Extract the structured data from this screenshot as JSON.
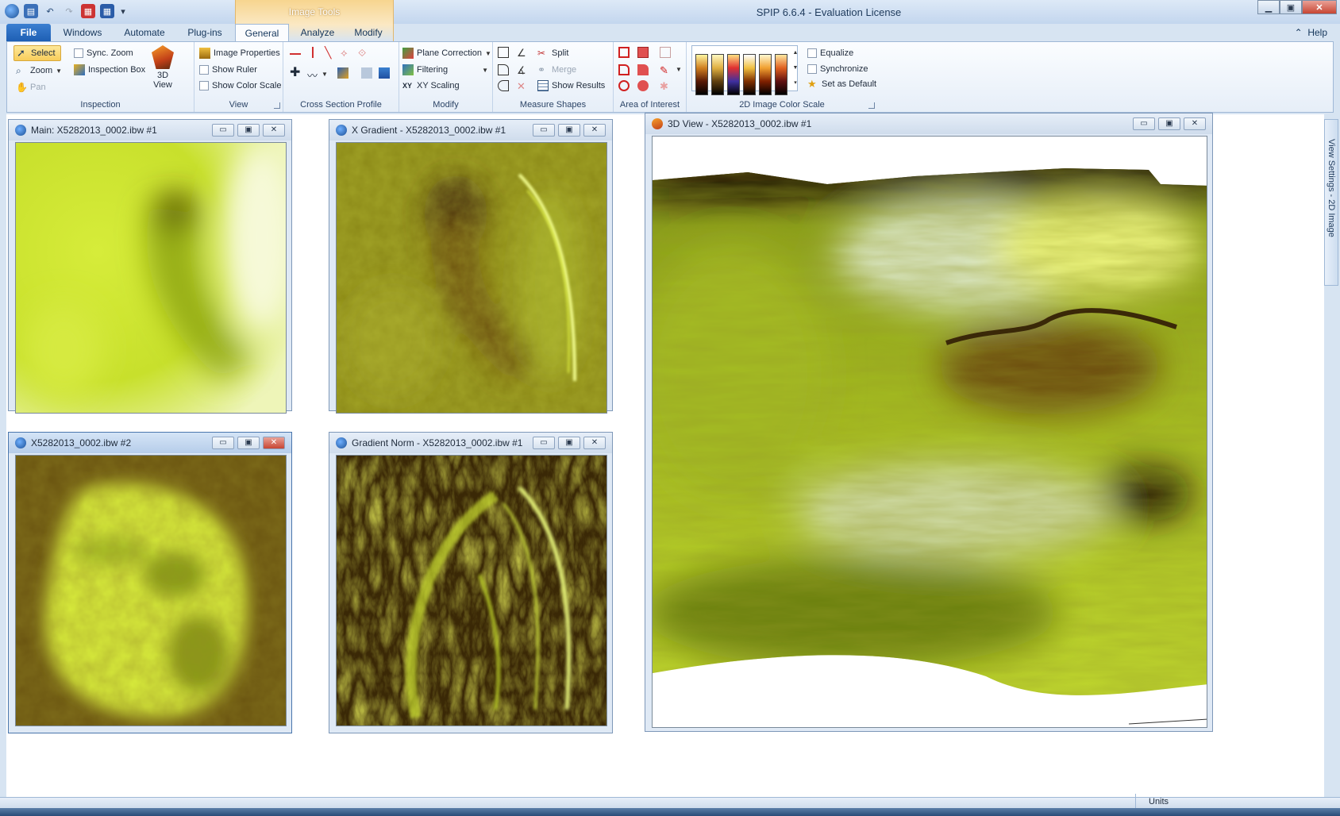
{
  "app": {
    "title": "SPIP 6.6.4 - Evaluation License",
    "contextual_tab": "Image Tools",
    "help_label": "Help"
  },
  "tabs": [
    {
      "label": "File"
    },
    {
      "label": "Windows"
    },
    {
      "label": "Automate"
    },
    {
      "label": "Plug-ins"
    },
    {
      "label": "General"
    },
    {
      "label": "Analyze"
    },
    {
      "label": "Modify"
    }
  ],
  "active_tab": "General",
  "ribbon": {
    "inspection": {
      "label": "Inspection",
      "select": "Select",
      "zoom": "Zoom",
      "pan": "Pan",
      "sync_zoom": "Sync. Zoom",
      "inspection_box": "Inspection Box",
      "view3d_line1": "3D",
      "view3d_line2": "View"
    },
    "view": {
      "label": "View",
      "image_properties": "Image Properties",
      "show_ruler": "Show Ruler",
      "show_color_scale": "Show Color Scale"
    },
    "cross_section": {
      "label": "Cross Section Profile"
    },
    "modify": {
      "label": "Modify",
      "plane_correction": "Plane Correction",
      "filtering": "Filtering",
      "xy_scaling": "XY Scaling"
    },
    "measure": {
      "label": "Measure Shapes",
      "split": "Split",
      "merge": "Merge",
      "show_results": "Show Results"
    },
    "aoi": {
      "label": "Area of Interest"
    },
    "color_scale": {
      "label": "2D Image Color Scale",
      "equalize": "Equalize",
      "synchronize": "Synchronize",
      "set_default": "Set as Default"
    }
  },
  "windows": {
    "main": "Main: X5282013_0002.ibw #1",
    "xgrad": "X Gradient - X5282013_0002.ibw #1",
    "view3d": "3D View - X5282013_0002.ibw #1",
    "second": "X5282013_0002.ibw #2",
    "gradnorm": "Gradient Norm - X5282013_0002.ibw #1"
  },
  "side_panel": "View Settings - 2D Image",
  "status": {
    "units": "Units"
  },
  "colors": {
    "ribbon_bg": "#e6eef8",
    "file_tab": "#1e5fb4",
    "surface_light": "#c8e02c",
    "surface_dark": "#2a1a05"
  }
}
